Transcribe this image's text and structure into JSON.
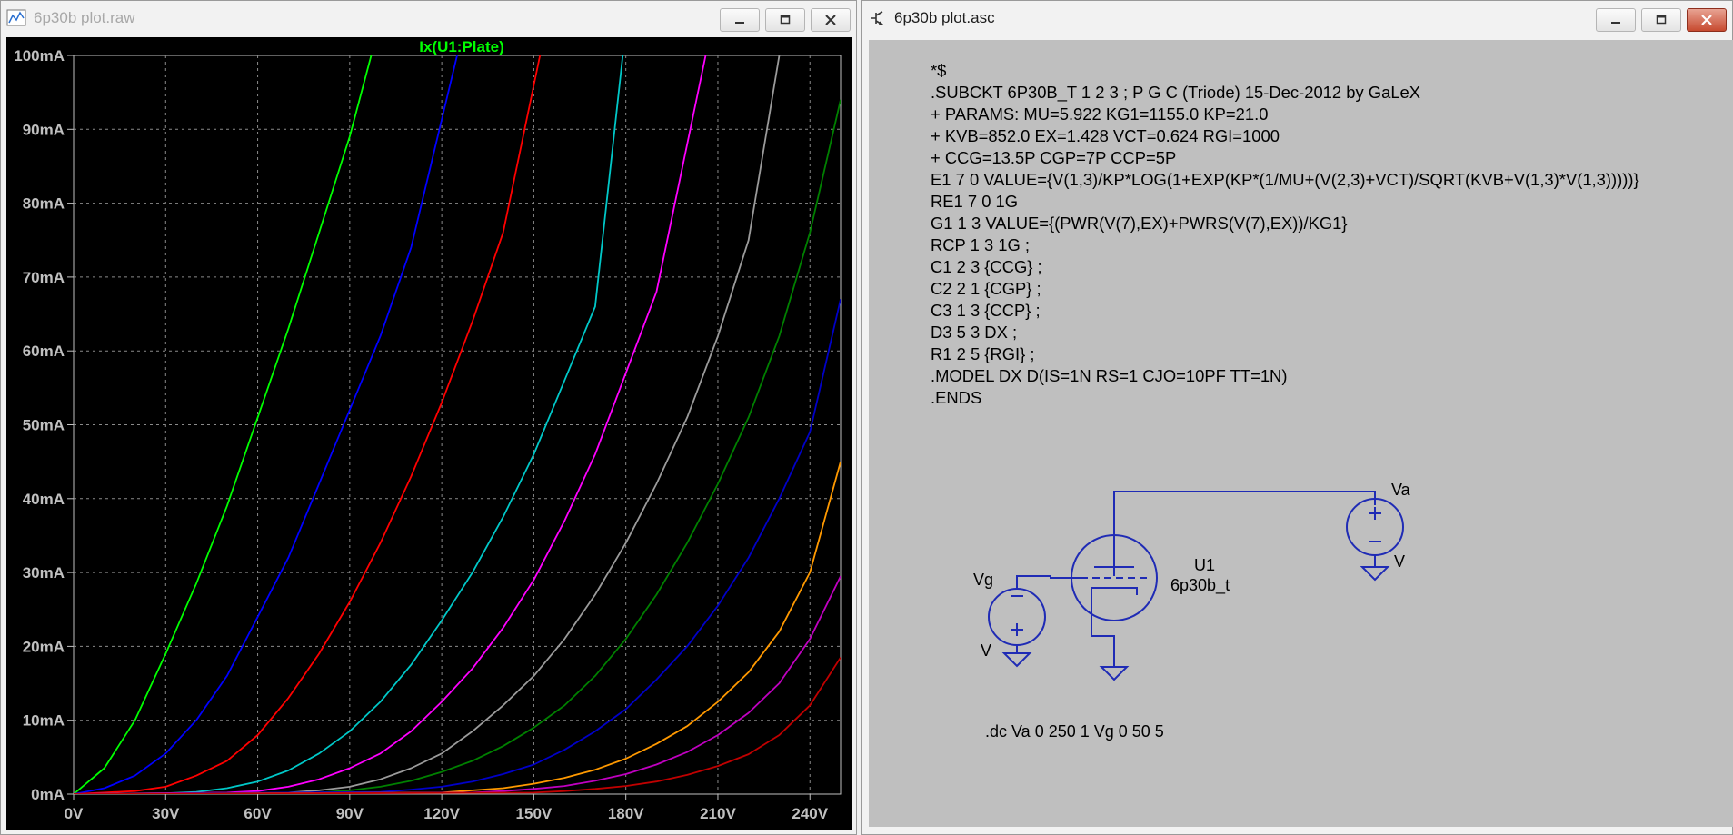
{
  "plot_window": {
    "title": "6p30b plot.raw",
    "icon": "waveform-plot-icon",
    "trace_label": "Ix(U1:Plate)",
    "trace_label_color": "#00ff00",
    "background": "#000000",
    "grid_color": "#8a8a8a",
    "axis_text_color": "#c0c0c0"
  },
  "asc_window": {
    "title": "6p30b plot.asc",
    "icon": "schematic-icon",
    "background": "#bfbfbf",
    "netlist": [
      "*$",
      ".SUBCKT 6P30B_T 1 2 3 ; P G C (Triode) 15-Dec-2012 by GaLeX",
      "+ PARAMS: MU=5.922 KG1=1155.0 KP=21.0",
      "+ KVB=852.0 EX=1.428 VCT=0.624 RGI=1000",
      "+ CCG=13.5P CGP=7P CCP=5P",
      "E1 7 0 VALUE={V(1,3)/KP*LOG(1+EXP(KP*(1/MU+(V(2,3)+VCT)/SQRT(KVB+V(1,3)*V(1,3)))))}",
      "RE1 7 0 1G",
      "G1 1 3 VALUE={(PWR(V(7),EX)+PWRS(V(7),EX))/KG1}",
      "RCP 1 3 1G ;",
      "C1 2 3 {CCG} ;",
      "C2 2 1 {CGP} ;",
      "C3 1 3 {CCP} ;",
      "D3 5 3 DX ;",
      "R1 2 5 {RGI} ;",
      ".MODEL DX D(IS=1N RS=1 CJO=10PF TT=1N)",
      ".ENDS"
    ],
    "schematic": {
      "wire_color": "#1f2bb5",
      "va_label": "Va",
      "va_value": "V",
      "vg_label": "Vg",
      "vg_value": "V",
      "u1_label": "U1",
      "u1_model": "6p30b_t",
      "directive": ".dc Va 0 250 1 Vg 0 50 5"
    }
  },
  "chart_data": {
    "type": "line",
    "title": "Ix(U1:Plate)",
    "xlabel": "",
    "ylabel": "",
    "xlim": [
      0,
      250
    ],
    "ylim": [
      0,
      100
    ],
    "x_ticks": [
      "0V",
      "30V",
      "60V",
      "90V",
      "120V",
      "150V",
      "180V",
      "210V",
      "240V"
    ],
    "x_tick_values": [
      0,
      30,
      60,
      90,
      120,
      150,
      180,
      210,
      240
    ],
    "y_ticks": [
      "0mA",
      "10mA",
      "20mA",
      "30mA",
      "40mA",
      "50mA",
      "60mA",
      "70mA",
      "80mA",
      "90mA",
      "100mA"
    ],
    "y_tick_values": [
      0,
      10,
      20,
      30,
      40,
      50,
      60,
      70,
      80,
      90,
      100
    ],
    "grid": true,
    "x_unit": "V",
    "y_unit": "mA",
    "series": [
      {
        "color": "#00ff00",
        "x": [
          0,
          10,
          20,
          30,
          40,
          50,
          60,
          70,
          80,
          90,
          97
        ],
        "y": [
          0,
          3.5,
          10,
          19,
          28.5,
          39,
          51,
          63,
          76,
          89,
          100
        ]
      },
      {
        "color": "#0000ff",
        "x": [
          0,
          10,
          20,
          30,
          40,
          50,
          60,
          70,
          80,
          90,
          100,
          110,
          125
        ],
        "y": [
          0,
          0.8,
          2.5,
          5.5,
          10,
          16,
          24,
          32,
          42,
          52,
          62,
          74,
          100
        ]
      },
      {
        "color": "#ff0000",
        "x": [
          0,
          20,
          30,
          40,
          50,
          60,
          70,
          80,
          90,
          100,
          110,
          120,
          130,
          140,
          152
        ],
        "y": [
          0,
          0.4,
          1,
          2.5,
          4.5,
          8,
          13,
          19,
          26,
          34,
          43,
          53,
          64,
          76,
          100
        ]
      },
      {
        "color": "#00c8c8",
        "x": [
          0,
          30,
          40,
          50,
          60,
          70,
          80,
          90,
          100,
          110,
          120,
          130,
          140,
          150,
          160,
          170,
          179
        ],
        "y": [
          0,
          0.1,
          0.3,
          0.8,
          1.7,
          3.2,
          5.5,
          8.5,
          12.5,
          17.5,
          23.5,
          30,
          37.5,
          46,
          56,
          66,
          100
        ]
      },
      {
        "color": "#ff00ff",
        "x": [
          0,
          50,
          60,
          70,
          80,
          90,
          100,
          110,
          120,
          130,
          140,
          150,
          160,
          170,
          180,
          190,
          206
        ],
        "y": [
          0,
          0.2,
          0.4,
          1,
          2,
          3.5,
          5.5,
          8.5,
          12.5,
          17,
          22.5,
          29,
          37,
          46,
          57,
          68,
          100
        ]
      },
      {
        "color": "#9b9b9b",
        "x": [
          0,
          60,
          70,
          80,
          90,
          100,
          110,
          120,
          130,
          140,
          150,
          160,
          170,
          180,
          190,
          200,
          210,
          220,
          230
        ],
        "y": [
          0,
          0.1,
          0.2,
          0.5,
          1,
          2,
          3.5,
          5.5,
          8.5,
          12,
          16,
          21,
          27,
          34,
          42,
          51,
          62,
          75,
          100
        ]
      },
      {
        "color": "#008000",
        "x": [
          0,
          80,
          90,
          100,
          110,
          120,
          130,
          140,
          150,
          160,
          170,
          180,
          190,
          200,
          210,
          220,
          230,
          240,
          250
        ],
        "y": [
          0,
          0.2,
          0.5,
          1,
          1.8,
          3,
          4.5,
          6.5,
          9,
          12,
          16,
          21,
          27,
          34,
          42,
          51,
          62,
          76,
          94
        ]
      },
      {
        "color": "#0000c8",
        "x": [
          0,
          100,
          110,
          120,
          130,
          140,
          150,
          160,
          170,
          180,
          190,
          200,
          210,
          220,
          230,
          240,
          250
        ],
        "y": [
          0,
          0.3,
          0.6,
          1,
          1.7,
          2.7,
          4,
          6,
          8.5,
          11.5,
          15.5,
          20,
          25.5,
          32,
          40,
          49,
          67
        ]
      },
      {
        "color": "#ff9900",
        "x": [
          0,
          120,
          130,
          140,
          150,
          160,
          170,
          180,
          190,
          200,
          210,
          220,
          230,
          240,
          250
        ],
        "y": [
          0,
          0.2,
          0.5,
          0.8,
          1.4,
          2.2,
          3.3,
          4.8,
          6.8,
          9.2,
          12.5,
          16.5,
          22,
          30,
          45
        ]
      },
      {
        "color": "#c000c0",
        "x": [
          0,
          130,
          140,
          150,
          160,
          170,
          180,
          190,
          200,
          210,
          220,
          230,
          240,
          250
        ],
        "y": [
          0,
          0.2,
          0.4,
          0.7,
          1.1,
          1.8,
          2.7,
          4,
          5.7,
          8,
          11,
          15,
          21,
          29.5
        ]
      },
      {
        "color": "#c00000",
        "x": [
          0,
          150,
          160,
          170,
          180,
          190,
          200,
          210,
          220,
          230,
          240,
          250
        ],
        "y": [
          0,
          0.2,
          0.4,
          0.7,
          1.1,
          1.7,
          2.6,
          3.8,
          5.4,
          8,
          12,
          18.5
        ]
      }
    ]
  }
}
